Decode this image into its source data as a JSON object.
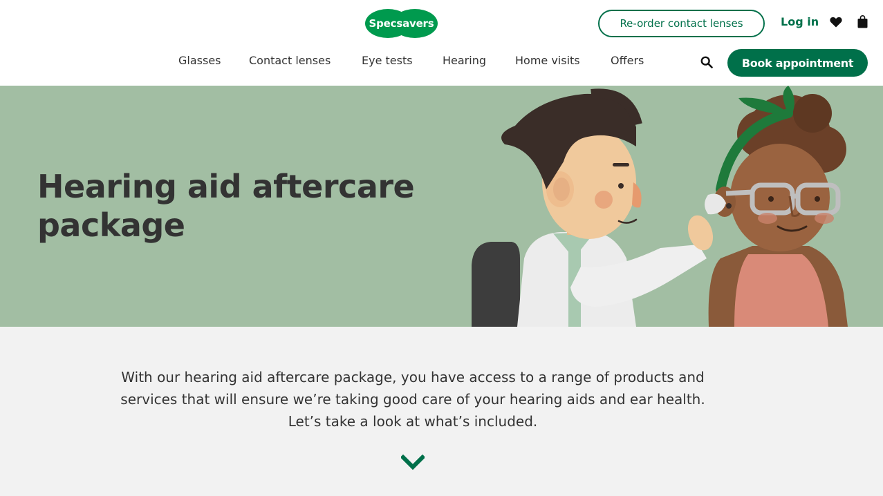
{
  "brand": {
    "logo_text": "Specsavers",
    "accent": "#00704a",
    "logo_green": "#009a4e",
    "hero_bg": "#a2bea3",
    "intro_bg": "#f2f2f2"
  },
  "header": {
    "reorder_label": "Re-order contact lenses",
    "login_label": "Log in",
    "wishlist_icon": "heart-icon",
    "basket_icon": "bag-icon",
    "search_icon": "search-icon",
    "book_label": "Book appointment"
  },
  "nav": {
    "items": [
      {
        "label": "Glasses"
      },
      {
        "label": "Contact lenses"
      },
      {
        "label": "Eye tests"
      },
      {
        "label": "Hearing"
      },
      {
        "label": "Home visits"
      },
      {
        "label": "Offers"
      }
    ]
  },
  "hero": {
    "title": "Hearing aid aftercare package"
  },
  "intro": {
    "text": "With our hearing aid aftercare package, you have access to a range of products and services that will ensure we’re taking good care of your hearing aids and ear health. Let’s take a look at what’s included.",
    "scroll_icon": "chevron-down-icon"
  }
}
